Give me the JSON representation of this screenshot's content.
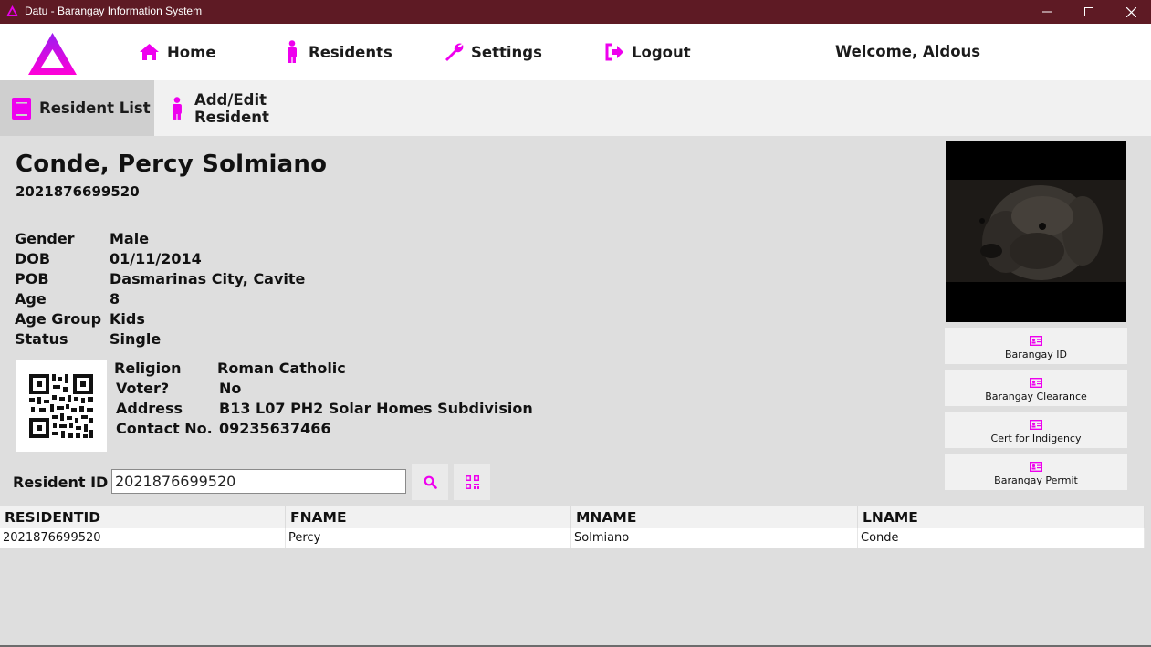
{
  "window": {
    "title": "Datu - Barangay Information System"
  },
  "nav": {
    "home": "Home",
    "residents": "Residents",
    "settings": "Settings",
    "logout": "Logout",
    "welcome": "Welcome, Aldous"
  },
  "subnav": {
    "resident_list": "Resident List",
    "add_edit": "Add/Edit Resident"
  },
  "resident": {
    "name": "Conde, Percy Solmiano",
    "id": "2021876699520",
    "fields": [
      {
        "label": "Gender",
        "value": "Male"
      },
      {
        "label": "DOB",
        "value": "01/11/2014"
      },
      {
        "label": "POB",
        "value": "Dasmarinas City, Cavite"
      },
      {
        "label": "Age",
        "value": "8"
      },
      {
        "label": "Age Group",
        "value": "Kids"
      },
      {
        "label": "Status",
        "value": "Single"
      }
    ],
    "fields2": [
      {
        "label": "Religion",
        "value": "Roman Catholic"
      },
      {
        "label": "Voter?",
        "value": "No"
      },
      {
        "label": "Address",
        "value": "B13 L07 PH2 Solar Homes Subdivision"
      },
      {
        "label": "Contact No.",
        "value": "09235637466"
      }
    ]
  },
  "side_buttons": {
    "barangay_id": "Barangay ID",
    "barangay_clearance": "Barangay Clearance",
    "cert_indigency": "Cert for Indigency",
    "barangay_permit": "Barangay Permit"
  },
  "search": {
    "label": "Resident ID",
    "value": "2021876699520"
  },
  "table": {
    "headers": [
      "RESIDENTID",
      "FNAME",
      "MNAME",
      "LNAME"
    ],
    "rows": [
      [
        "2021876699520",
        "Percy",
        "Solmiano",
        "Conde"
      ]
    ]
  },
  "colors": {
    "accent": "#ee00ee",
    "titlebar": "#5e1a24"
  },
  "icons": {
    "home": "home-icon",
    "residents": "person-icon",
    "settings": "wrench-icon",
    "logout": "logout-icon",
    "search": "search-icon",
    "qr": "qr-icon",
    "id_card": "id-card-icon"
  }
}
